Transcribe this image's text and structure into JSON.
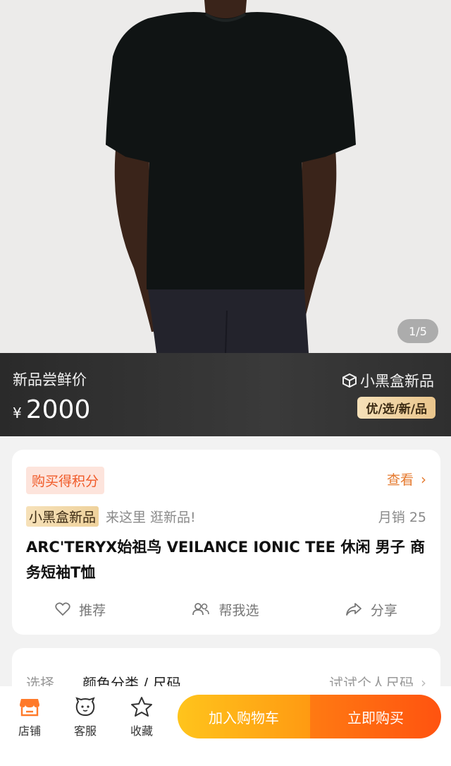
{
  "gallery": {
    "counter": "1/5"
  },
  "price_banner": {
    "label": "新品尝鲜价",
    "currency": "¥",
    "price": "2000",
    "brand": "小黑盒新品",
    "tag": "优/选/新/品"
  },
  "info": {
    "points_tag": "购买得积分",
    "view_link": "查看",
    "badge": "小黑盒新品",
    "slogan": "来这里 逛新品!",
    "sales": "月销 25",
    "title": "ARC'TERYX始祖鸟 VEILANCE IONIC TEE  休闲 男子 商务短袖T恤",
    "actions": {
      "recommend": "推荐",
      "help_choose": "帮我选",
      "share": "分享"
    }
  },
  "select": {
    "label": "选择",
    "value": "颜色分类 / 尺码",
    "right": "试试个人尺码"
  },
  "bottom_bar": {
    "store": "店铺",
    "service": "客服",
    "favorite": "收藏",
    "add_to_cart": "加入购物车",
    "buy_now": "立即购买"
  },
  "colors": {
    "accent_orange": "#ff5310",
    "accent_yellow": "#ffc41c",
    "link_orange": "#e57a2f"
  }
}
